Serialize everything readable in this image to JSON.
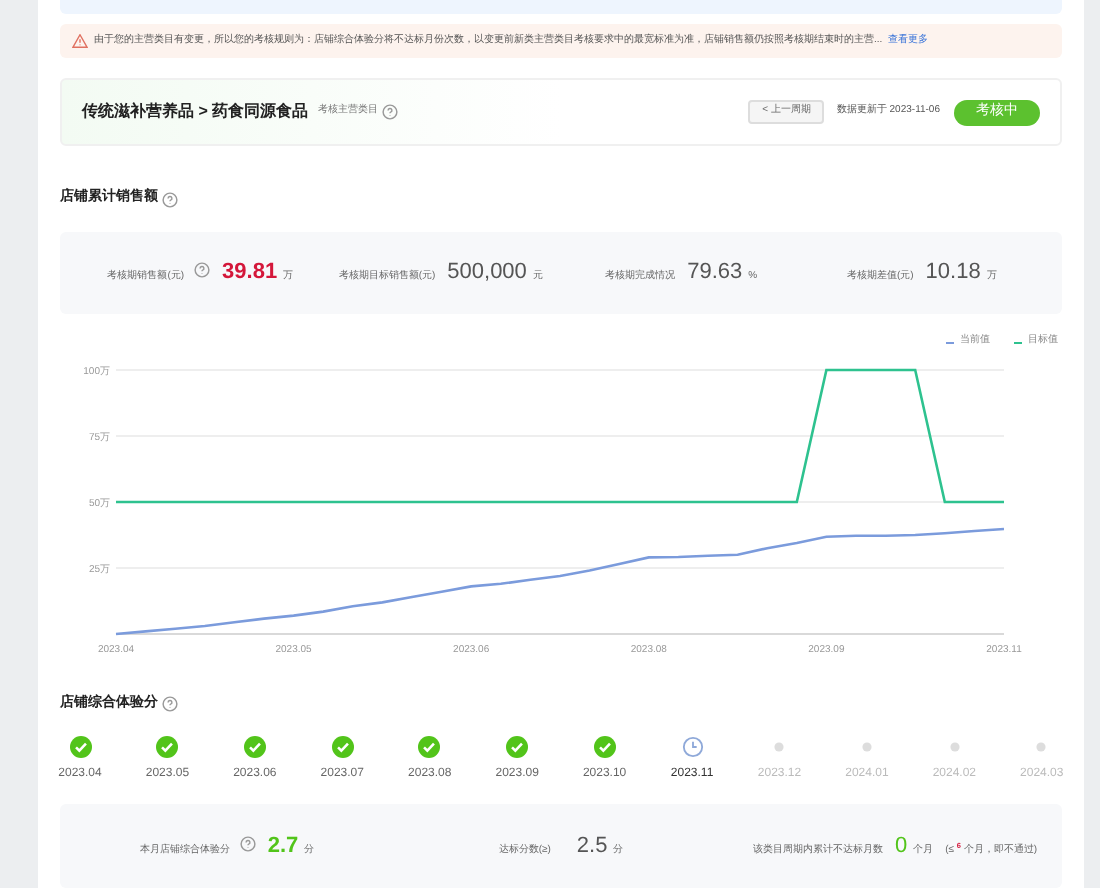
{
  "warning": {
    "text": "由于您的主营类目有变更，所以您的考核规则为：店铺综合体验分将不达标月份次数，以变更前新类主营类目考核要求中的最宽标准为准，店铺销售额仍按照考核期结束时的主营...",
    "link": "查看更多"
  },
  "header": {
    "category": "传统滋补营养品 > 药食同源食品",
    "category_hint": "考核主营类目",
    "prev_button": "< 上一周期",
    "updated": "数据更新于 2023-11-06",
    "status": "考核中"
  },
  "sales": {
    "title": "店铺累计销售额",
    "stats": [
      {
        "label": "考核期销售额(元)",
        "value": "39.81",
        "unit": "万",
        "highlight": true,
        "help": true
      },
      {
        "label": "考核期目标销售额(元)",
        "value": "500,000",
        "unit": "元",
        "highlight": false,
        "help": false
      },
      {
        "label": "考核期完成情况",
        "value": "79.63",
        "unit": "%",
        "highlight": false,
        "help": false
      },
      {
        "label": "考核期差值(元)",
        "value": "10.18",
        "unit": "万",
        "highlight": false,
        "help": false
      }
    ],
    "chart_data": {
      "type": "line",
      "categories": [
        "2023.04",
        null,
        null,
        null,
        null,
        null,
        "2023.05",
        null,
        null,
        null,
        null,
        null,
        "2023.06",
        null,
        null,
        null,
        null,
        null,
        "2023.08",
        null,
        null,
        null,
        null,
        null,
        "2023.09",
        null,
        null,
        null,
        null,
        null,
        "2023.11"
      ],
      "series": [
        {
          "name": "当前值",
          "color": "#7b9bdc",
          "values": [
            0,
            1,
            2,
            3,
            4.5,
            5.8,
            7,
            8.5,
            10.5,
            12,
            14,
            16,
            18,
            19,
            20.5,
            22,
            24,
            26.5,
            29,
            29.2,
            29.6,
            30,
            32.5,
            34.5,
            36.8,
            37.2,
            37.2,
            37.5,
            38.2,
            39,
            39.8
          ]
        },
        {
          "name": "目标值",
          "color": "#2ec28f",
          "values": [
            50,
            50,
            50,
            50,
            50,
            50,
            50,
            50,
            50,
            50,
            50,
            50,
            50,
            50,
            50,
            50,
            50,
            50,
            50,
            50,
            50,
            50,
            50,
            50,
            100,
            100,
            100,
            100,
            50,
            50,
            50
          ]
        }
      ],
      "ylim": [
        0,
        100
      ],
      "grid": true,
      "yticks": [
        {
          "value": 25,
          "label": "25万"
        },
        {
          "value": 50,
          "label": "50万"
        },
        {
          "value": 75,
          "label": "75万"
        },
        {
          "value": 100,
          "label": "100万"
        }
      ]
    }
  },
  "experience": {
    "title": "店铺综合体验分",
    "months": [
      {
        "label": "2023.04",
        "kind": "done"
      },
      {
        "label": "2023.05",
        "kind": "done"
      },
      {
        "label": "2023.06",
        "kind": "done"
      },
      {
        "label": "2023.07",
        "kind": "done"
      },
      {
        "label": "2023.08",
        "kind": "done"
      },
      {
        "label": "2023.09",
        "kind": "done"
      },
      {
        "label": "2023.10",
        "kind": "done"
      },
      {
        "label": "2023.11",
        "kind": "current"
      },
      {
        "label": "2023.12",
        "kind": "pending"
      },
      {
        "label": "2024.01",
        "kind": "pending"
      },
      {
        "label": "2024.02",
        "kind": "pending"
      },
      {
        "label": "2024.03",
        "kind": "pending"
      }
    ],
    "score": {
      "label": "本月店铺综合体验分",
      "value": "2.7",
      "unit": "分"
    },
    "target": {
      "label": "达标分数(≥)",
      "value": "2.5",
      "unit": "分"
    },
    "failed": {
      "label": "该类目周期内累计不达标月数",
      "value": "0",
      "unit": "个月",
      "note": "(≤ $^{6}$ 个月，即不通过)"
    }
  }
}
